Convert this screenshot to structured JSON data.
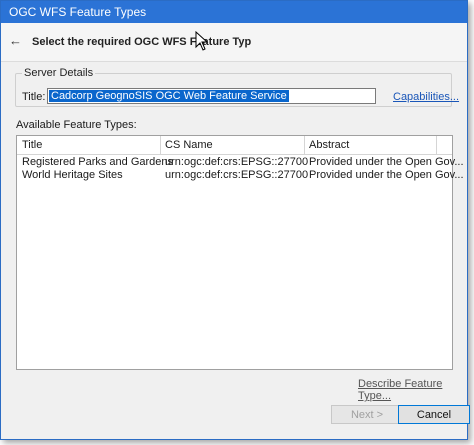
{
  "window": {
    "title": "OGC WFS Feature Types"
  },
  "header": {
    "text": "Select the required OGC WFS Feature Typ"
  },
  "server_details": {
    "legend": "Server Details",
    "title_label": "Title:",
    "title_value": "Cadcorp GeognoSIS OGC Web Feature Service",
    "capabilities_link": "Capabilities..."
  },
  "feature_types": {
    "label": "Available Feature Types:",
    "columns": [
      "Title",
      "CS Name",
      "Abstract"
    ],
    "rows": [
      [
        "Registered Parks and Gardens",
        "urn:ogc:def:crs:EPSG::27700",
        "Provided under the Open Gov..."
      ],
      [
        "World Heritage Sites",
        "urn:ogc:def:crs:EPSG::27700",
        "Provided under the Open Gov..."
      ]
    ]
  },
  "describe_link": "Describe Feature Type...",
  "buttons": {
    "next": "Next >",
    "cancel": "Cancel"
  },
  "colors": {
    "titlebar": "#2b73d6",
    "selection": "#0a66cc",
    "link": "#1a56b8"
  }
}
